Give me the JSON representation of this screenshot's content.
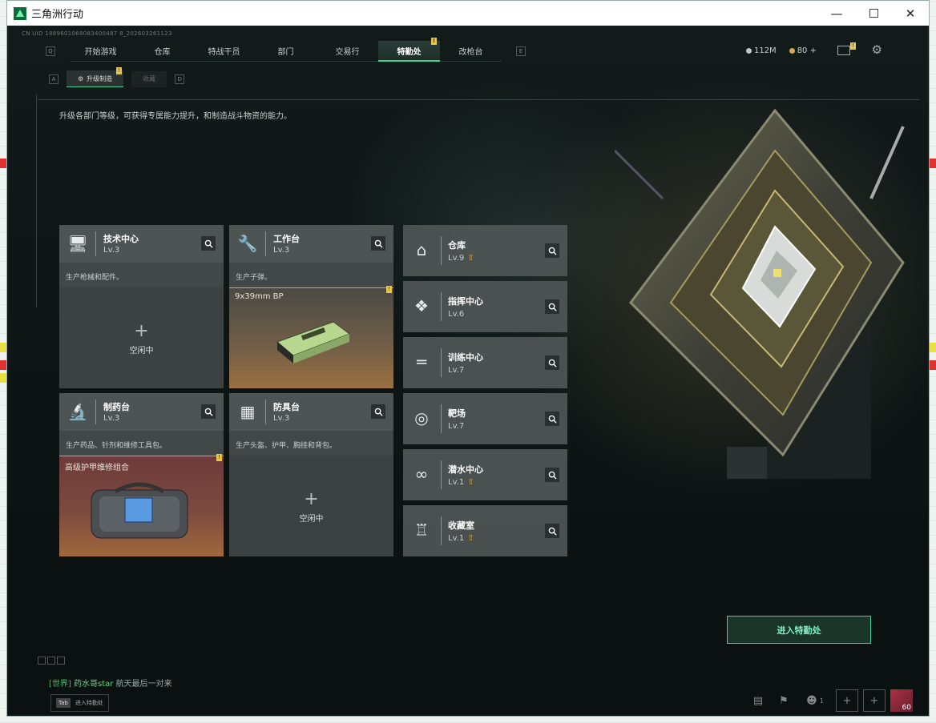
{
  "window": {
    "title": "三角洲行动",
    "controls": [
      "minimize-icon",
      "maximize-icon",
      "close-icon"
    ]
  },
  "game": {
    "cnid": "CN UID 1889601068083400487 8_202603261123",
    "nav": {
      "left_key": "Q",
      "right_key": "E",
      "tabs": [
        {
          "label": "开始游戏",
          "active": false
        },
        {
          "label": "仓库",
          "active": false
        },
        {
          "label": "特战干员",
          "active": false
        },
        {
          "label": "部门",
          "active": false
        },
        {
          "label": "交易行",
          "active": false
        },
        {
          "label": "特勤处",
          "active": true,
          "badge": "!"
        },
        {
          "label": "改枪台",
          "active": false
        }
      ]
    },
    "currency": {
      "money": "112M",
      "coins": "80",
      "coins_plus": "+"
    },
    "subnav": {
      "left_key": "A",
      "right_key": "D",
      "tabs": [
        {
          "label": "升级制造",
          "active": true,
          "badge": "!"
        },
        {
          "label": "收藏",
          "active": false
        }
      ]
    },
    "description": "升级各部门等级，可获得专属能力提升，和制造战斗物资的能力。",
    "production_cards": [
      {
        "name": "技术中心",
        "level": "Lv.3",
        "icon": "monitor-icon",
        "desc": "生产枪械和配件。",
        "state": "idle",
        "idle_label": "空闲中"
      },
      {
        "name": "工作台",
        "level": "Lv.3",
        "icon": "tools-icon",
        "desc": "生产子弹。",
        "state": "item",
        "item_name": "9x39mm BP",
        "badge": "!"
      },
      {
        "name": "制药台",
        "level": "Lv.3",
        "icon": "microscope-icon",
        "desc": "生产药品、针剂和维修工具包。",
        "state": "item",
        "item_name": "高级护甲维修组合",
        "badge": "!"
      },
      {
        "name": "防具台",
        "level": "Lv.3",
        "icon": "armor-icon",
        "desc": "生产头盔、护甲、胸挂和背包。",
        "state": "idle",
        "idle_label": "空闲中"
      }
    ],
    "department_cards": [
      {
        "name": "仓库",
        "level": "Lv.9",
        "upgradable": true,
        "icon": "warehouse-icon"
      },
      {
        "name": "指挥中心",
        "level": "Lv.6",
        "upgradable": false,
        "icon": "command-icon"
      },
      {
        "name": "训练中心",
        "level": "Lv.7",
        "upgradable": false,
        "icon": "dumbbell-icon"
      },
      {
        "name": "靶场",
        "level": "Lv.7",
        "upgradable": false,
        "icon": "target-icon"
      },
      {
        "name": "潜水中心",
        "level": "Lv.1",
        "upgradable": true,
        "icon": "diving-goggles-icon"
      },
      {
        "name": "收藏室",
        "level": "Lv.1",
        "upgradable": true,
        "icon": "trophy-icon"
      }
    ],
    "enter_button": "进入特勤处",
    "chat": {
      "channel": "[世界]",
      "player": "药水哥star",
      "message": "航天最后一对来"
    },
    "tab_hint": {
      "key": "Tab",
      "label": "进入特勤处"
    },
    "player_level": "60",
    "squad_count": "1"
  },
  "colors": {
    "accent": "#43d39a",
    "badge": "#e8c64a",
    "card_bg": "#4e5454",
    "bg_dark": "#0f1414"
  }
}
